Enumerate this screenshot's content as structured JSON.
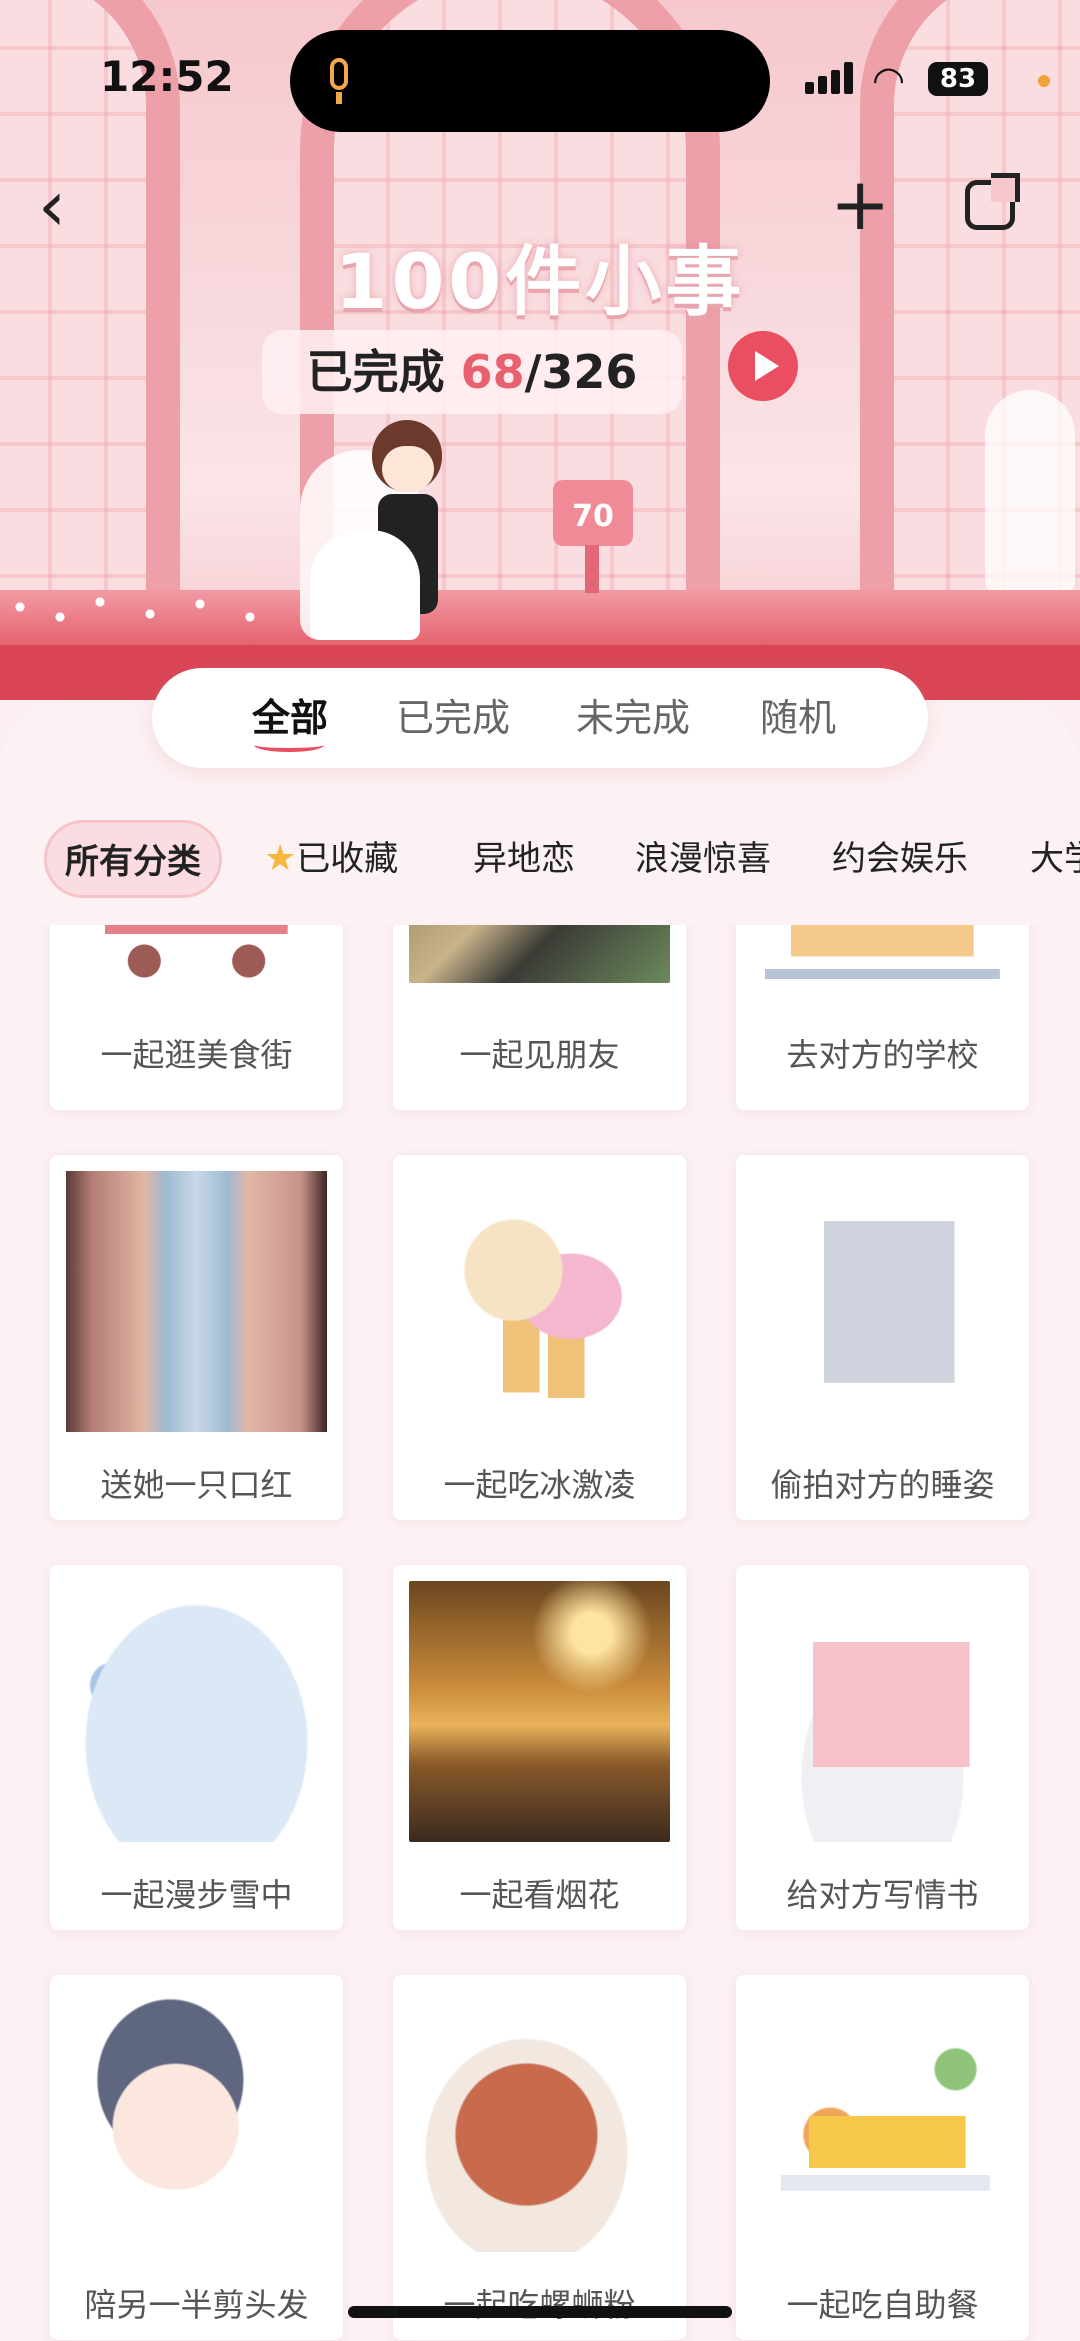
{
  "status_bar": {
    "time": "12:52",
    "battery": "83"
  },
  "header": {
    "title": "100件小事",
    "progress_prefix": "已完成 ",
    "progress_done": "68",
    "progress_total": "/326",
    "sign_number": "70",
    "icons": {
      "back": "chevron-left-icon",
      "add": "plus-icon",
      "share": "share-icon",
      "play": "play-icon"
    }
  },
  "tabs": [
    {
      "label": "全部",
      "active": true
    },
    {
      "label": "已完成",
      "active": false
    },
    {
      "label": "未完成",
      "active": false
    },
    {
      "label": "随机",
      "active": false
    }
  ],
  "chips": [
    {
      "label": "所有分类",
      "active": true
    },
    {
      "label": "已收藏",
      "icon": "star-icon"
    },
    {
      "label": "异地恋"
    },
    {
      "label": "浪漫惊喜"
    },
    {
      "label": "约会娱乐"
    },
    {
      "label": "大学"
    }
  ],
  "cards": [
    {
      "label": "一起逛美食街",
      "illustration": "food-cart"
    },
    {
      "label": "一起见朋友",
      "illustration": "food-photo"
    },
    {
      "label": "去对方的学校",
      "illustration": "school"
    },
    {
      "label": "送她一只口红",
      "illustration": "lipstick-photo"
    },
    {
      "label": "一起吃冰激凌",
      "illustration": "ice-cream"
    },
    {
      "label": "偷拍对方的睡姿",
      "illustration": "sleeping"
    },
    {
      "label": "一起漫步雪中",
      "illustration": "snow"
    },
    {
      "label": "一起看烟花",
      "illustration": "fireworks-photo"
    },
    {
      "label": "给对方写情书",
      "illustration": "love-letter"
    },
    {
      "label": "陪另一半剪头发",
      "illustration": "haircut"
    },
    {
      "label": "一起吃螺蛳粉",
      "illustration": "noodles"
    },
    {
      "label": "一起吃自助餐",
      "illustration": "buffet"
    }
  ],
  "colors": {
    "accent": "#e94f60",
    "sheet_bg": "#fcf1f3",
    "chip_active_bg": "#fbdde1"
  }
}
